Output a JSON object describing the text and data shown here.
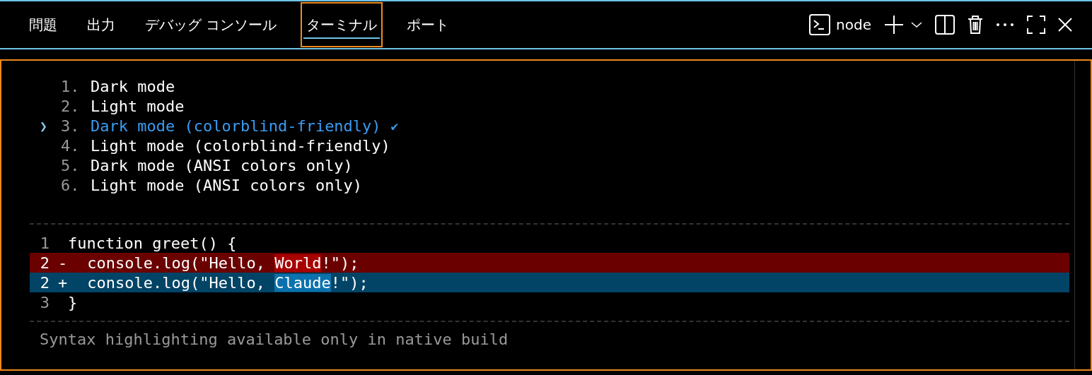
{
  "tabs": [
    {
      "label": "問題",
      "selected": false
    },
    {
      "label": "出力",
      "selected": false
    },
    {
      "label": "デバッグ コンソール",
      "selected": false
    },
    {
      "label": "ターミナル",
      "selected": true
    },
    {
      "label": "ポート",
      "selected": false
    }
  ],
  "terminal_name": "node",
  "options": [
    {
      "number": "1.",
      "label": "Dark mode",
      "selected": false
    },
    {
      "number": "2.",
      "label": "Light mode",
      "selected": false
    },
    {
      "number": "3.",
      "label": "Dark mode (colorblind-friendly)",
      "selected": true
    },
    {
      "number": "4.",
      "label": "Light mode (colorblind-friendly)",
      "selected": false
    },
    {
      "number": "5.",
      "label": "Dark mode (ANSI colors only)",
      "selected": false
    },
    {
      "number": "6.",
      "label": "Light mode (ANSI colors only)",
      "selected": false
    }
  ],
  "selection_marker": "❯",
  "check_mark": "✔",
  "diff": [
    {
      "kind": "context",
      "line": "1",
      "segments": [
        {
          "text": "function greet() {",
          "highlight": false
        }
      ]
    },
    {
      "kind": "removed",
      "line": "2",
      "sign": "-",
      "segments": [
        {
          "text": " console.log(\"Hello, ",
          "highlight": false
        },
        {
          "text": "World",
          "highlight": true
        },
        {
          "text": "!\");",
          "highlight": false
        }
      ]
    },
    {
      "kind": "added",
      "line": "2",
      "sign": "+",
      "segments": [
        {
          "text": " console.log(\"Hello, ",
          "highlight": false
        },
        {
          "text": "Claude",
          "highlight": true
        },
        {
          "text": "!\");",
          "highlight": false
        }
      ]
    },
    {
      "kind": "context",
      "line": "3",
      "segments": [
        {
          "text": "}",
          "highlight": false
        }
      ]
    }
  ],
  "footer": "Syntax highlighting available only in native build"
}
